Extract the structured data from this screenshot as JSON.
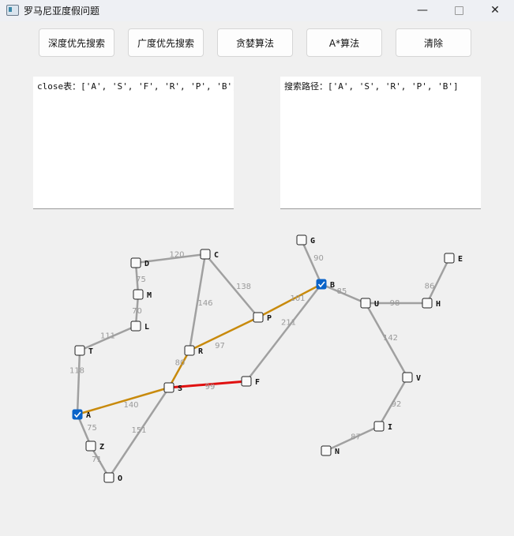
{
  "window": {
    "title": "罗马尼亚度假问题",
    "minimize": "—",
    "close": "✕"
  },
  "toolbar": {
    "dfs": "深度优先搜索",
    "bfs": "广度优先搜索",
    "greedy": "贪婪算法",
    "astar": "A*算法",
    "clear": "清除"
  },
  "close_list": "close表：['A', 'S', 'F', 'R', 'P', 'B']",
  "search_path": "搜索路径：['A', 'S', 'R', 'P', 'B']",
  "colors": {
    "edge": "#a0a0a0",
    "path_edge": "#c88a0c",
    "highlight_edge": "#e01010",
    "checked": "#0a63c8"
  },
  "graph": {
    "nodes": [
      {
        "id": "A",
        "checked": true
      },
      {
        "id": "Z",
        "checked": false
      },
      {
        "id": "O",
        "checked": false
      },
      {
        "id": "T",
        "checked": false
      },
      {
        "id": "L",
        "checked": false
      },
      {
        "id": "M",
        "checked": false
      },
      {
        "id": "D",
        "checked": false
      },
      {
        "id": "C",
        "checked": false
      },
      {
        "id": "S",
        "checked": false
      },
      {
        "id": "R",
        "checked": false
      },
      {
        "id": "P",
        "checked": false
      },
      {
        "id": "F",
        "checked": false
      },
      {
        "id": "B",
        "checked": true
      },
      {
        "id": "G",
        "checked": false
      },
      {
        "id": "U",
        "checked": false
      },
      {
        "id": "H",
        "checked": false
      },
      {
        "id": "E",
        "checked": false
      },
      {
        "id": "V",
        "checked": false
      },
      {
        "id": "I",
        "checked": false
      },
      {
        "id": "N",
        "checked": false
      }
    ],
    "edges": [
      {
        "from": "A",
        "to": "Z",
        "w": "75",
        "style": "normal"
      },
      {
        "from": "Z",
        "to": "O",
        "w": "71",
        "style": "normal"
      },
      {
        "from": "O",
        "to": "S",
        "w": "151",
        "style": "normal"
      },
      {
        "from": "A",
        "to": "T",
        "w": "118",
        "style": "normal"
      },
      {
        "from": "T",
        "to": "L",
        "w": "111",
        "style": "normal"
      },
      {
        "from": "L",
        "to": "M",
        "w": "70",
        "style": "normal"
      },
      {
        "from": "M",
        "to": "D",
        "w": "75",
        "style": "normal"
      },
      {
        "from": "D",
        "to": "C",
        "w": "120",
        "style": "normal"
      },
      {
        "from": "C",
        "to": "R",
        "w": "146",
        "style": "normal"
      },
      {
        "from": "C",
        "to": "P",
        "w": "138",
        "style": "normal"
      },
      {
        "from": "A",
        "to": "S",
        "w": "140",
        "style": "path"
      },
      {
        "from": "S",
        "to": "R",
        "w": "80",
        "style": "path"
      },
      {
        "from": "R",
        "to": "P",
        "w": "97",
        "style": "path"
      },
      {
        "from": "P",
        "to": "B",
        "w": "101",
        "style": "path"
      },
      {
        "from": "S",
        "to": "F",
        "w": "99",
        "style": "highlight"
      },
      {
        "from": "F",
        "to": "B",
        "w": "211",
        "style": "normal"
      },
      {
        "from": "B",
        "to": "G",
        "w": "90",
        "style": "normal"
      },
      {
        "from": "B",
        "to": "U",
        "w": "85",
        "style": "normal"
      },
      {
        "from": "U",
        "to": "H",
        "w": "98",
        "style": "normal"
      },
      {
        "from": "H",
        "to": "E",
        "w": "86",
        "style": "normal"
      },
      {
        "from": "U",
        "to": "V",
        "w": "142",
        "style": "normal"
      },
      {
        "from": "V",
        "to": "I",
        "w": "92",
        "style": "normal"
      },
      {
        "from": "I",
        "to": "N",
        "w": "87",
        "style": "normal"
      }
    ]
  }
}
